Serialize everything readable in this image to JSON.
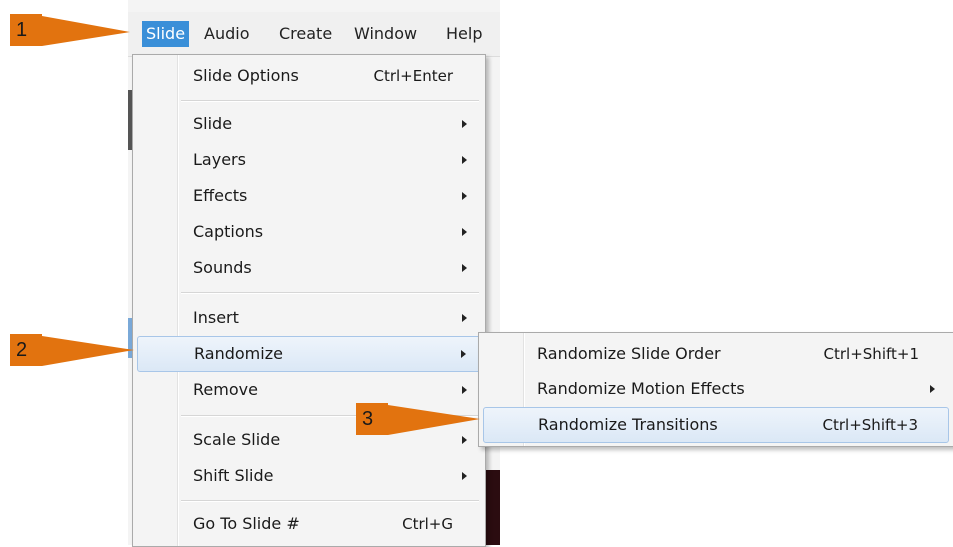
{
  "menubar": {
    "items": [
      "Slide",
      "Audio",
      "Create",
      "Window",
      "Help"
    ]
  },
  "menu": {
    "items": [
      {
        "label": "Slide Options",
        "shortcut": "Ctrl+Enter"
      },
      {
        "label": "Slide"
      },
      {
        "label": "Layers"
      },
      {
        "label": "Effects"
      },
      {
        "label": "Captions"
      },
      {
        "label": "Sounds"
      },
      {
        "label": "Insert"
      },
      {
        "label": "Randomize"
      },
      {
        "label": "Remove"
      },
      {
        "label": "Scale Slide"
      },
      {
        "label": "Shift Slide"
      },
      {
        "label": "Go To Slide #",
        "shortcut": "Ctrl+G"
      }
    ]
  },
  "submenu": {
    "items": [
      {
        "label": "Randomize Slide Order",
        "shortcut": "Ctrl+Shift+1"
      },
      {
        "label": "Randomize Motion Effects"
      },
      {
        "label": "Randomize Transitions",
        "shortcut": "Ctrl+Shift+3"
      }
    ]
  },
  "callouts": [
    "1",
    "2",
    "3"
  ],
  "colors": {
    "callout": "#e2730f",
    "menu_active": "#3a8fd8",
    "highlight": "#dbe8f6"
  }
}
